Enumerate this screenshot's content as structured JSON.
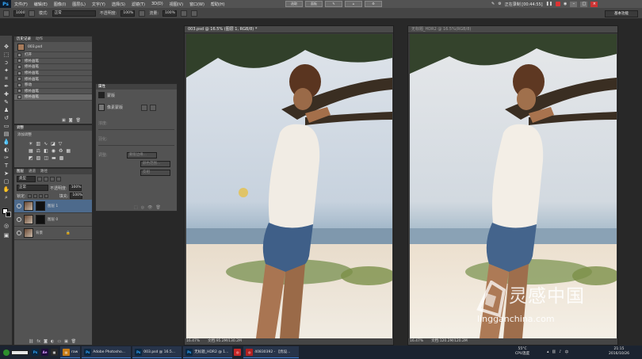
{
  "menubar": {
    "logo": "Ps",
    "items": [
      "文件(F)",
      "编辑(E)",
      "图像(I)",
      "图层(L)",
      "文字(Y)",
      "选择(S)",
      "滤镜(T)",
      "3D(D)",
      "视图(V)",
      "窗口(W)",
      "帮助(H)"
    ],
    "center_buttons": [
      "选取",
      "面板",
      "",
      "",
      ""
    ],
    "recording_label": "正在录制 [00:44:55]"
  },
  "options": {
    "brush_size": "1000",
    "mode_label": "模式:",
    "mode_value": "正常",
    "opacity_label": "不透明度:",
    "opacity_value": "100%",
    "flow_label": "流量:",
    "flow_value": "100%",
    "workspace": "基本功能"
  },
  "history": {
    "tabs": [
      "历史记录",
      "动作"
    ],
    "snapshot": "003.psd",
    "rows": [
      "打开",
      "修补画笔",
      "修补画笔",
      "修补画笔",
      "修补画笔",
      "移动",
      "修补画笔",
      "修补画笔"
    ]
  },
  "adjust": {
    "tabs": [
      "调整"
    ],
    "title": "添加调整"
  },
  "properties": {
    "title": "属性",
    "subtitle": "蒙版",
    "mask_label": "像素蒙版",
    "density_label": "浓度:",
    "feather_label": "羽化:",
    "refine_label": "调整:",
    "buttons": [
      "蒙版边缘...",
      "颜色范围...",
      "反相"
    ]
  },
  "layers": {
    "tabs": [
      "图层",
      "通道",
      "路径"
    ],
    "kind_label": "类型",
    "blend_value": "正常",
    "opacity_label": "不透明度:",
    "opacity_value": "100%",
    "lock_label": "锁定:",
    "fill_label": "填充:",
    "fill_value": "100%",
    "rows": [
      {
        "name": "图层 1"
      },
      {
        "name": "图层 0"
      },
      {
        "name": "背景"
      }
    ]
  },
  "doc1": {
    "tab": "003.psd @ 16.5% (图层 1, RGB/8) *",
    "zoom": "16.47%",
    "size": "文档:95.2M/130.2M"
  },
  "doc2": {
    "tab": "无标题_HDR2 @ 16.5%(RGB/8)",
    "zoom": "16.47%",
    "size": "文档:120.2M/120.2M"
  },
  "watermark": {
    "cn": "灵感中国",
    "url": "lingganchina.com"
  },
  "taskbar": {
    "items": [
      {
        "label": "raw",
        "color": "#c77b16"
      },
      {
        "label": "Adobe Photosho...",
        "color": "#0b2741"
      },
      {
        "label": "003.psd @ 16.5...",
        "color": "#0b2741"
      },
      {
        "label": "无标题_HDR2 @ 1...",
        "color": "#0b2741"
      },
      {
        "label": "40830392 - 【优设...",
        "color": "#b02020"
      }
    ],
    "temperature": "55°C",
    "cpu_label": "CPU温度",
    "time": "21:15",
    "date": "2016/10/26"
  },
  "colors": {
    "ui_panel": "#535353",
    "ui_dark": "#282828",
    "selection": "#4d6a8c",
    "taskbar": "#1b2330"
  }
}
